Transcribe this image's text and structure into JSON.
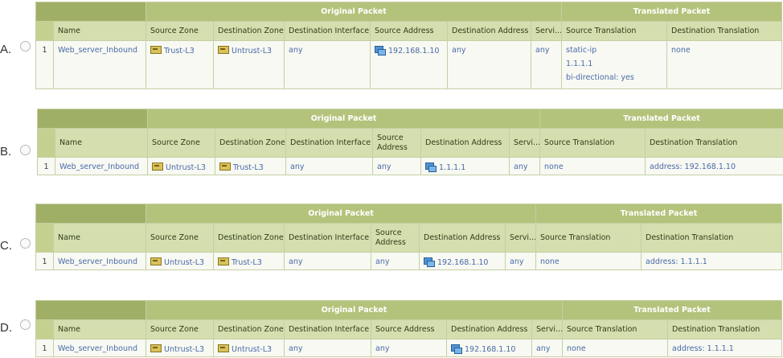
{
  "headers": {
    "original_packet": "Original Packet",
    "translated_packet": "Translated Packet",
    "name": "Name",
    "source_zone": "Source Zone",
    "destination_zone": "Destination Zone",
    "destination_interface": "Destination Interface",
    "source_address": "Source Address",
    "destination_address": "Destination Address",
    "service": "Servi...",
    "source_translation": "Source Translation",
    "destination_translation": "Destination Translation"
  },
  "options": [
    {
      "letter": "A.",
      "row": {
        "num": "1",
        "name": "Web_server_Inbound",
        "source_zone": "Trust-L3",
        "destination_zone": "Untrust-L3",
        "destination_interface": "any",
        "source_address": "192.168.1.10",
        "destination_address": "any",
        "service": "any",
        "source_translation": [
          "static-ip",
          "1.1.1.1",
          "bi-directional: yes"
        ],
        "destination_translation": "none"
      }
    },
    {
      "letter": "B.",
      "row": {
        "num": "1",
        "name": "Web_server_Inbound",
        "source_zone": "Untrust-L3",
        "destination_zone": "Trust-L3",
        "destination_interface": "any",
        "source_address": "any",
        "destination_address": "1.1.1.1",
        "service": "any",
        "source_translation": "none",
        "destination_translation": "address: 192.168.1.10"
      }
    },
    {
      "letter": "C.",
      "row": {
        "num": "1",
        "name": "Web_server_Inbound",
        "source_zone": "Untrust-L3",
        "destination_zone": "Trust-L3",
        "destination_interface": "any",
        "source_address": "any",
        "destination_address": "192.168.1.10",
        "service": "any",
        "source_translation": "none",
        "destination_translation": "address: 1.1.1.1"
      }
    },
    {
      "letter": "D.",
      "row": {
        "num": "1",
        "name": "Web_server_Inbound",
        "source_zone": "Untrust-L3",
        "destination_zone": "Untrust-L3",
        "destination_interface": "any",
        "source_address": "any",
        "destination_address": "192.168.1.10",
        "service": "any",
        "source_translation": "none",
        "destination_translation": "address: 1.1.1.1"
      }
    }
  ]
}
